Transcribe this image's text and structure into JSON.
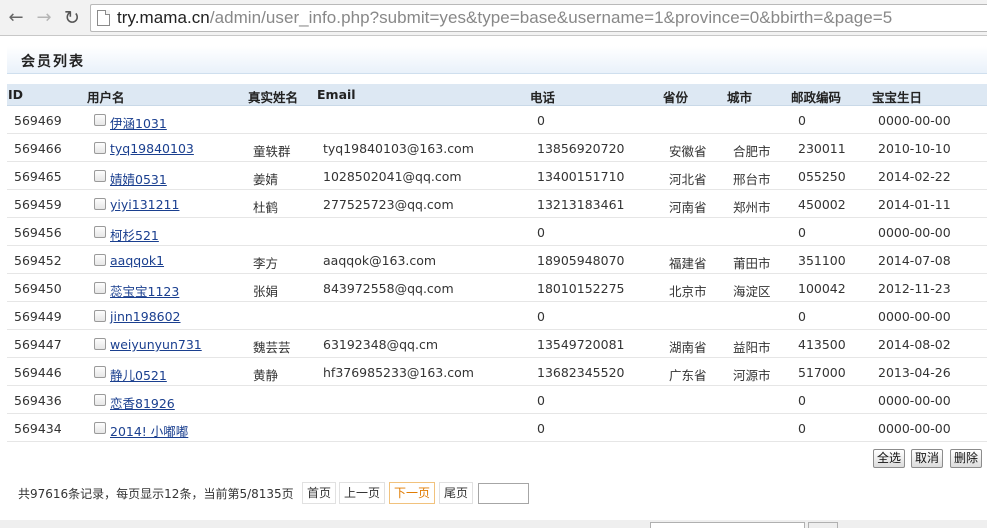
{
  "browser": {
    "url_host": "try.mama.cn",
    "url_path": "/admin/user_info.php?submit=yes&type=base&username=1&province=0&bbirth=&page=5"
  },
  "section": {
    "title": "会员列表"
  },
  "table": {
    "headers": {
      "id": "ID",
      "username": "用户名",
      "realname": "真实姓名",
      "email": "Email",
      "phone": "电话",
      "province": "省份",
      "city": "城市",
      "zip": "邮政编码",
      "birthday": "宝宝生日"
    },
    "rows": [
      {
        "id": "569469",
        "username": "伊涵1031",
        "realname": "",
        "email": "",
        "phone": "0",
        "province": "",
        "city": "",
        "zip": "0",
        "birthday": "0000-00-00"
      },
      {
        "id": "569466",
        "username": "tyq19840103",
        "realname": "童轶群",
        "email": "tyq19840103@163.com",
        "phone": "13856920720",
        "province": "安徽省",
        "city": "合肥市",
        "zip": "230011",
        "birthday": "2010-10-10"
      },
      {
        "id": "569465",
        "username": "婧婧0531",
        "realname": "姜婧",
        "email": "1028502041@qq.com",
        "phone": "13400151710",
        "province": "河北省",
        "city": "邢台市",
        "zip": "055250",
        "birthday": "2014-02-22"
      },
      {
        "id": "569459",
        "username": "yiyi131211",
        "realname": "杜鹤",
        "email": "277525723@qq.com",
        "phone": "13213183461",
        "province": "河南省",
        "city": "郑州市",
        "zip": "450002",
        "birthday": "2014-01-11"
      },
      {
        "id": "569456",
        "username": "柯杉521",
        "realname": "",
        "email": "",
        "phone": "0",
        "province": "",
        "city": "",
        "zip": "0",
        "birthday": "0000-00-00"
      },
      {
        "id": "569452",
        "username": "aaqqok1",
        "realname": "李方",
        "email": "aaqqok@163.com",
        "phone": "18905948070",
        "province": "福建省",
        "city": "莆田市",
        "zip": "351100",
        "birthday": "2014-07-08"
      },
      {
        "id": "569450",
        "username": "蕊宝宝1123",
        "realname": "张娟",
        "email": "843972558@qq.com",
        "phone": "18010152275",
        "province": "北京市",
        "city": "海淀区",
        "zip": "100042",
        "birthday": "2012-11-23"
      },
      {
        "id": "569449",
        "username": "jinn198602",
        "realname": "",
        "email": "",
        "phone": "0",
        "province": "",
        "city": "",
        "zip": "0",
        "birthday": "0000-00-00"
      },
      {
        "id": "569447",
        "username": "weiyunyun731",
        "realname": "魏芸芸",
        "email": "63192348@qq.cm",
        "phone": "13549720081",
        "province": "湖南省",
        "city": "益阳市",
        "zip": "413500",
        "birthday": "2014-08-02"
      },
      {
        "id": "569446",
        "username": "静儿0521",
        "realname": "黄静",
        "email": "hf376985233@163.com",
        "phone": "13682345520",
        "province": "广东省",
        "city": "河源市",
        "zip": "517000",
        "birthday": "2013-04-26"
      },
      {
        "id": "569436",
        "username": "恋香81926",
        "realname": "",
        "email": "",
        "phone": "0",
        "province": "",
        "city": "",
        "zip": "0",
        "birthday": "0000-00-00"
      },
      {
        "id": "569434",
        "username": "2014! 小嘟嘟",
        "realname": "",
        "email": "",
        "phone": "0",
        "province": "",
        "city": "",
        "zip": "0",
        "birthday": "0000-00-00"
      }
    ]
  },
  "actions": {
    "select_all": "全选",
    "cancel": "取消",
    "delete": "删除"
  },
  "pager": {
    "info": "共97616条记录，每页显示12条，当前第5/8135页",
    "first": "首页",
    "prev": "上一页",
    "next": "下一页",
    "last": "尾页",
    "jump_value": ""
  },
  "colors": {
    "header_bg": "#dde8f3",
    "link": "#1a3f8f",
    "pager_active": "#e07b00"
  }
}
